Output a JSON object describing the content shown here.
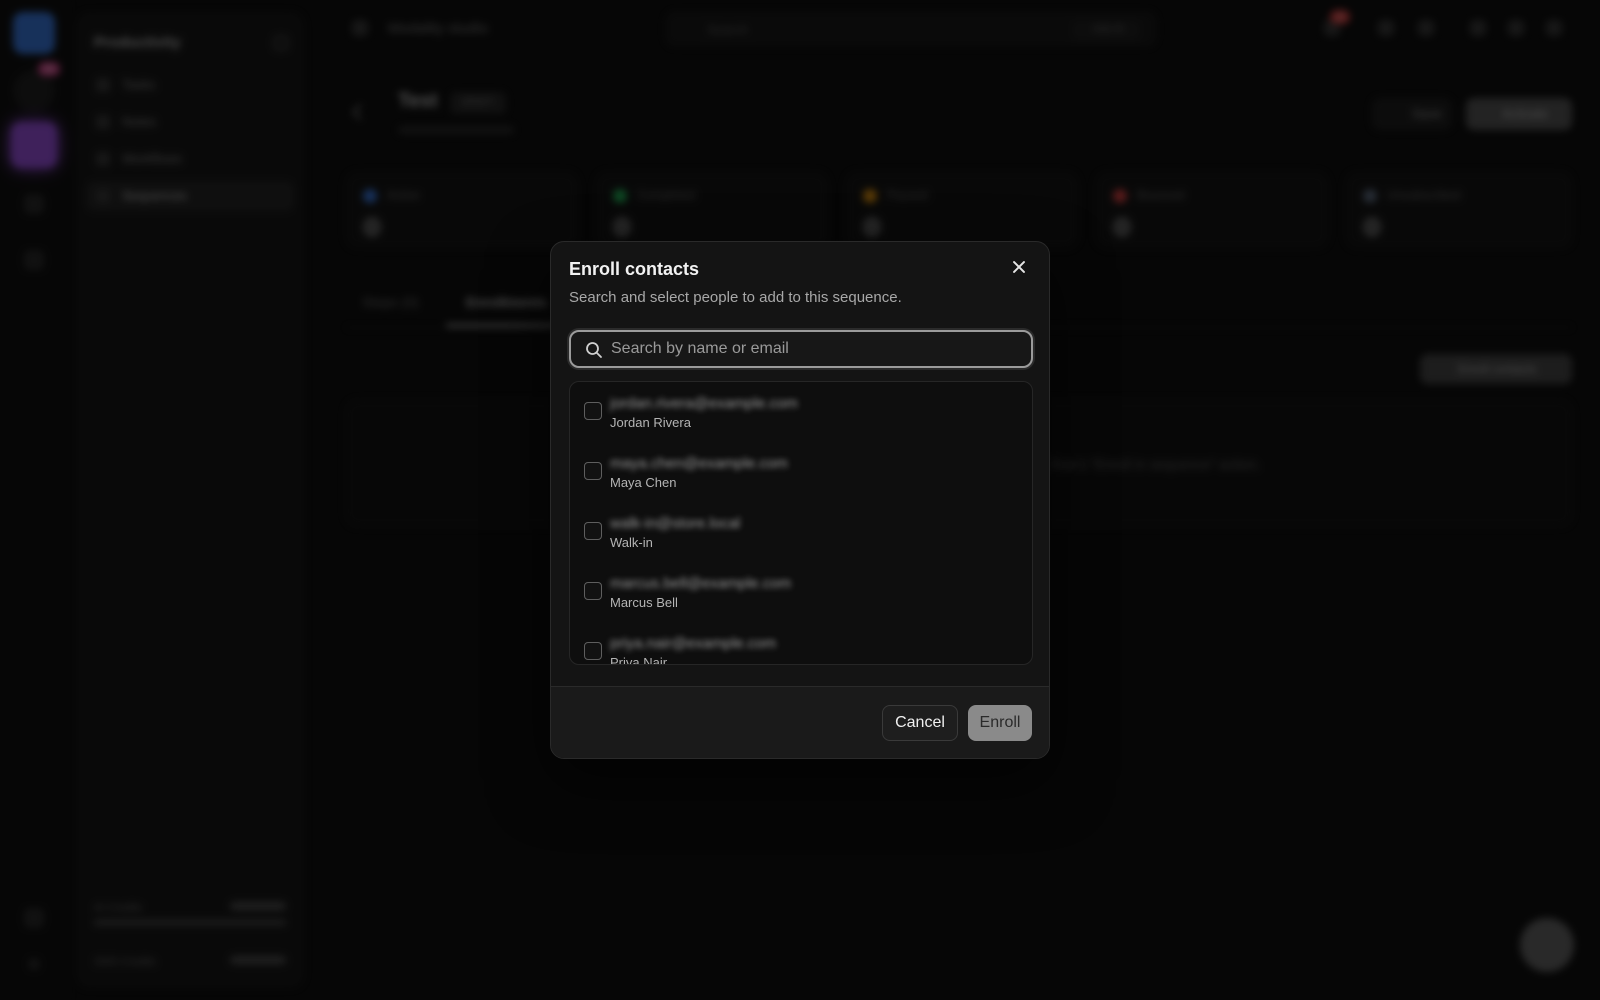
{
  "background": {
    "sidebar": {
      "title": "Productivity",
      "items": [
        {
          "label": "Tasks"
        },
        {
          "label": "Notes"
        },
        {
          "label": "Workflows"
        },
        {
          "label": "Sequences"
        }
      ],
      "credits": [
        {
          "label": "AI Credits"
        },
        {
          "label": "SMS Credits"
        }
      ]
    },
    "rail": {
      "badge": "99"
    },
    "topbar": {
      "title": "Modality studio",
      "search_placeholder": "Search",
      "ask_label": "Ask AI",
      "notif_badge": "9"
    },
    "page": {
      "title": "Test",
      "status": "DRAFT",
      "save_label": "Save",
      "activate_label": "Activate"
    },
    "stats": [
      {
        "label": "Active",
        "value": "0",
        "color": "#3b82f6"
      },
      {
        "label": "Completed",
        "value": "0",
        "color": "#22c55e"
      },
      {
        "label": "Paused",
        "value": "0",
        "color": "#f59e0b"
      },
      {
        "label": "Bounced",
        "value": "0",
        "color": "#ef4444"
      },
      {
        "label": "Unsubscribed",
        "value": "0",
        "color": "#64748b"
      }
    ],
    "tabs": [
      {
        "label": "Steps (0)"
      },
      {
        "label": "Enrollments"
      }
    ],
    "enroll_contacts_label": "Enroll contacts",
    "empty_text": "...flow's \"Enroll in sequence\" action."
  },
  "modal": {
    "title": "Enroll contacts",
    "description": "Search and select people to add to this sequence.",
    "search": {
      "placeholder": "Search by name or email",
      "value": ""
    },
    "contacts": [
      {
        "email": "jordan.rivera@example.com",
        "name": "Jordan Rivera",
        "checked": false
      },
      {
        "email": "maya.chen@example.com",
        "name": "Maya Chen",
        "checked": false
      },
      {
        "email": "walk-in@store.local",
        "name": "Walk-in",
        "checked": false
      },
      {
        "email": "marcus.bell@example.com",
        "name": "Marcus Bell",
        "checked": false
      },
      {
        "email": "priya.nair@example.com",
        "name": "Priya Nair",
        "checked": false
      }
    ],
    "cancel_label": "Cancel",
    "enroll_label": "Enroll"
  },
  "icons": {
    "close": "close-icon",
    "search": "search-icon"
  }
}
